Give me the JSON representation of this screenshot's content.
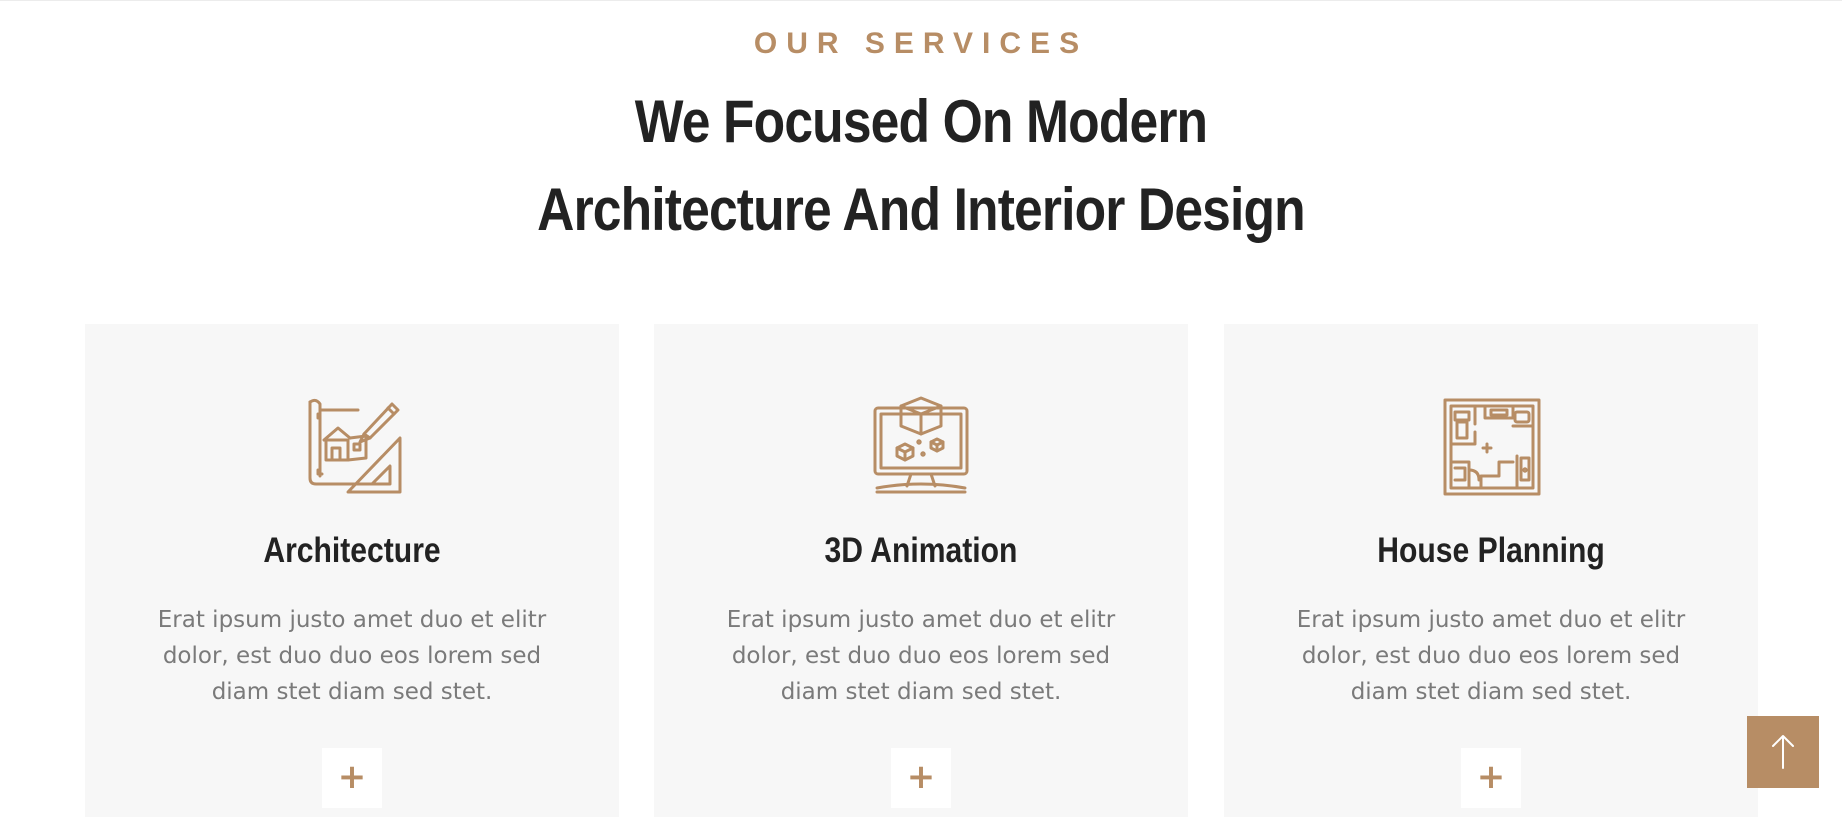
{
  "section": {
    "eyebrow": "OUR SERVICES",
    "headline_line1": "We Focused On Modern",
    "headline_line2": "Architecture And Interior Design"
  },
  "cards": [
    {
      "icon": "architecture-blueprint-icon",
      "title": "Architecture",
      "desc_line1": "Erat ipsum justo amet duo et elitr",
      "desc_line2": "dolor, est duo duo eos lorem sed",
      "desc_line3": "diam stet diam sed stet.",
      "button": "+"
    },
    {
      "icon": "3d-animation-monitor-icon",
      "title": "3D Animation",
      "desc_line1": "Erat ipsum justo amet duo et elitr",
      "desc_line2": "dolor, est duo duo eos lorem sed",
      "desc_line3": "diam stet diam sed stet.",
      "button": "+"
    },
    {
      "icon": "floor-plan-icon",
      "title": "House Planning",
      "desc_line1": "Erat ipsum justo amet duo et elitr",
      "desc_line2": "dolor, est duo duo eos lorem sed",
      "desc_line3": "diam stet diam sed stet.",
      "button": "+"
    }
  ],
  "back_to_top": {
    "icon": "arrow-up-icon"
  },
  "colors": {
    "accent": "#B78D65",
    "heading": "#222222",
    "body_text": "#7A7A7A",
    "card_bg": "#F7F7F7"
  }
}
